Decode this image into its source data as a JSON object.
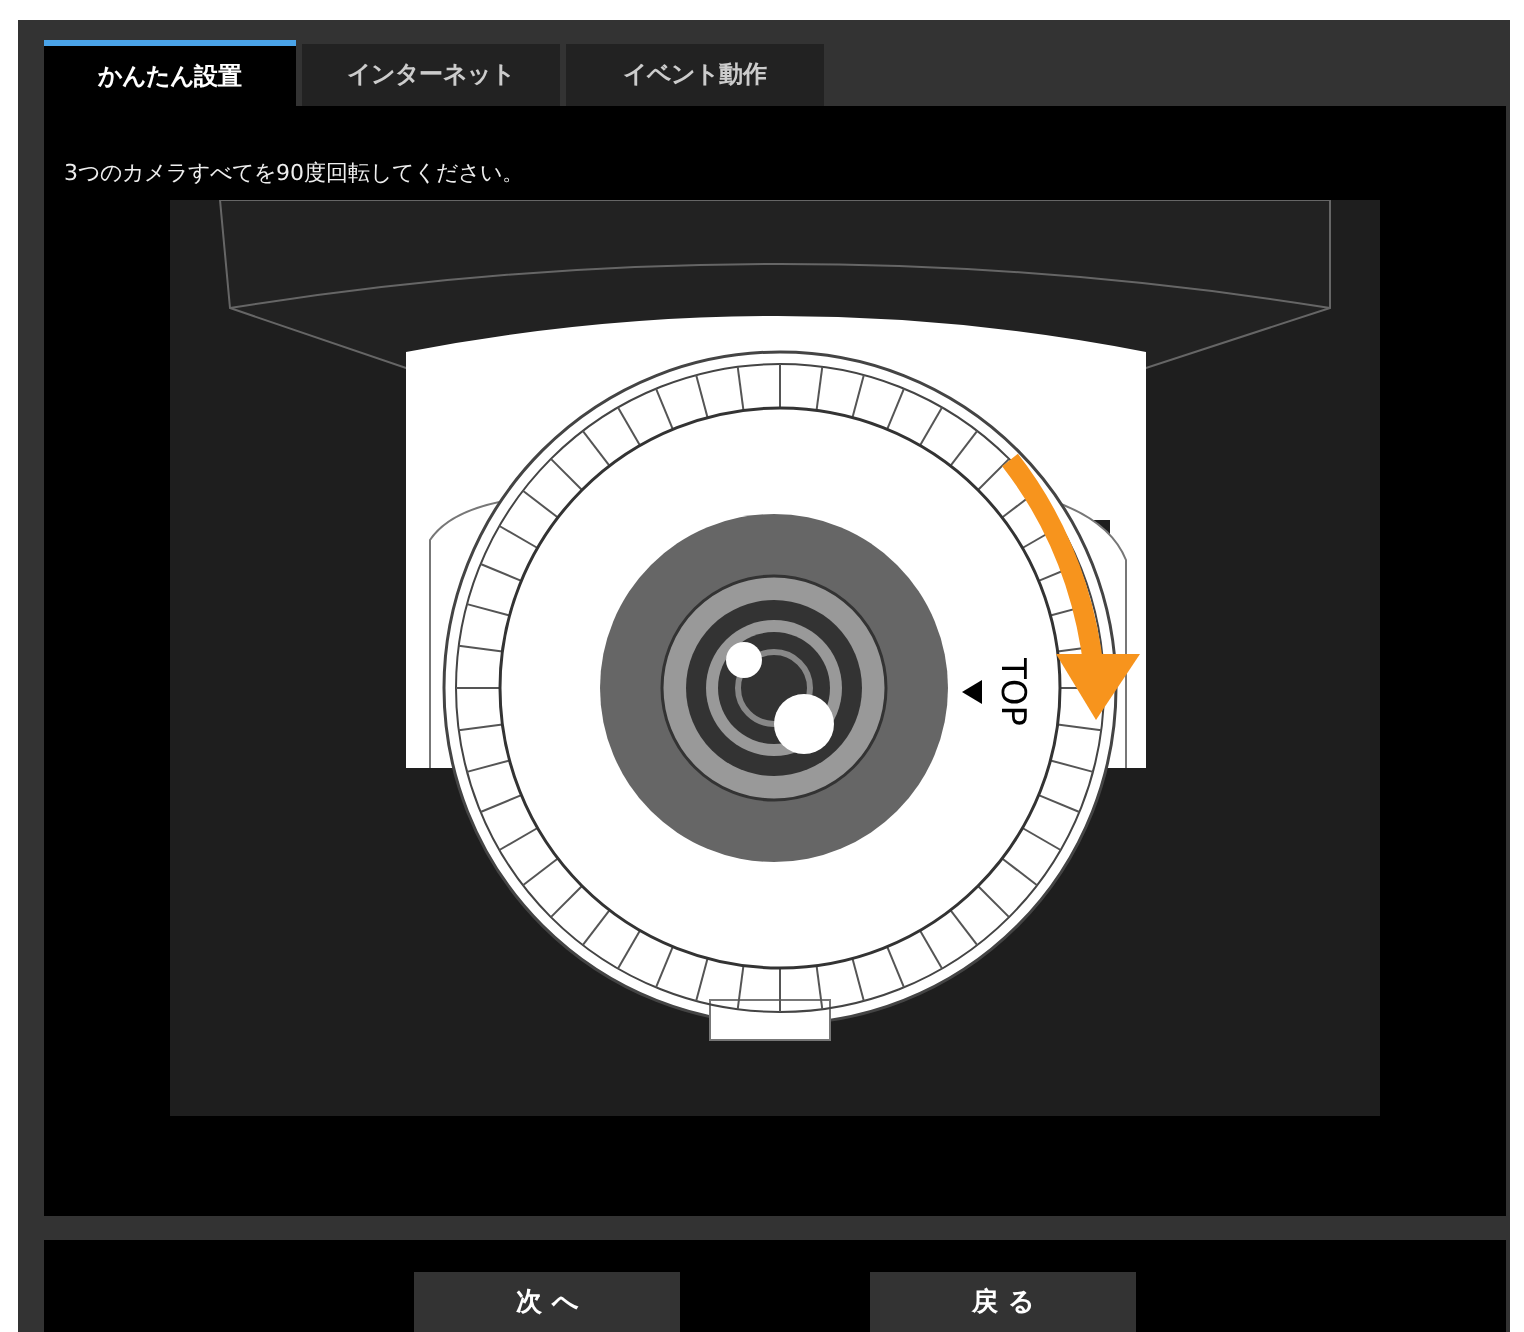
{
  "tabs": [
    {
      "label": "かんたん設置",
      "selected": true
    },
    {
      "label": "インターネット",
      "selected": false
    },
    {
      "label": "イベント動作",
      "selected": false
    }
  ],
  "instruction": "3つのカメラすべてを90度回転してください。",
  "illustration": {
    "top_label": "TOP"
  },
  "buttons": [
    {
      "label": "次 へ"
    },
    {
      "label": "戻 る"
    }
  ]
}
